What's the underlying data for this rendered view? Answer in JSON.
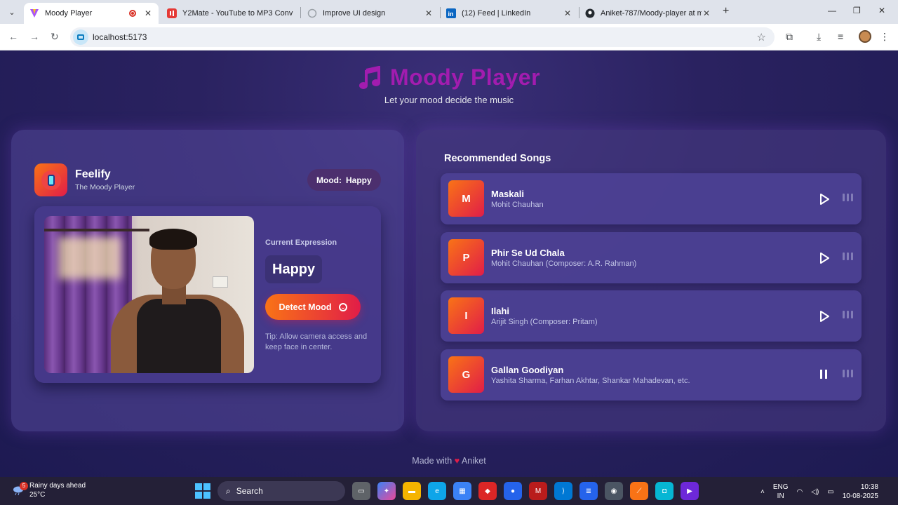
{
  "browser": {
    "tabs": [
      {
        "title": "Moody Player",
        "active": true
      },
      {
        "title": "Y2Mate - YouTube to MP3 Conv"
      },
      {
        "title": "Improve UI design"
      },
      {
        "title": "(12) Feed | LinkedIn"
      },
      {
        "title": "Aniket-787/Moody-player at m"
      }
    ],
    "url": "localhost:5173"
  },
  "header": {
    "title": "Moody Player",
    "tagline": "Let your mood decide the music"
  },
  "detector": {
    "brand_name": "Feelify",
    "brand_sub": "The Moody Player",
    "mood_label": "Mood:",
    "mood_value": "Happy",
    "expression_label": "Current Expression",
    "expression_value": "Happy",
    "detect_button": "Detect Mood",
    "tip": "Tip: Allow camera access and keep face in center."
  },
  "recommended": {
    "title": "Recommended Songs",
    "songs": [
      {
        "initial": "M",
        "title": "Maskali",
        "artist": "Mohit Chauhan",
        "state": "play"
      },
      {
        "initial": "P",
        "title": "Phir Se Ud Chala",
        "artist": "Mohit Chauhan (Composer: A.R. Rahman)",
        "state": "play"
      },
      {
        "initial": "I",
        "title": "Ilahi",
        "artist": "Arijit Singh (Composer: Pritam)",
        "state": "play"
      },
      {
        "initial": "G",
        "title": "Gallan Goodiyan",
        "artist": "Yashita Sharma, Farhan Akhtar, Shankar Mahadevan, etc.",
        "state": "pause"
      }
    ]
  },
  "footer": {
    "made_with": "Made with",
    "author": "Aniket"
  },
  "taskbar": {
    "weather_badge": "5",
    "weather_text": "Rainy days ahead",
    "temperature": "25°C",
    "search": "Search",
    "lang_top": "ENG",
    "lang_bottom": "IN",
    "time": "10:38",
    "date": "10-08-2025"
  },
  "colors": {
    "accent": "#a21caf",
    "button_gradient_start": "#f97316",
    "button_gradient_end": "#e11d48"
  }
}
